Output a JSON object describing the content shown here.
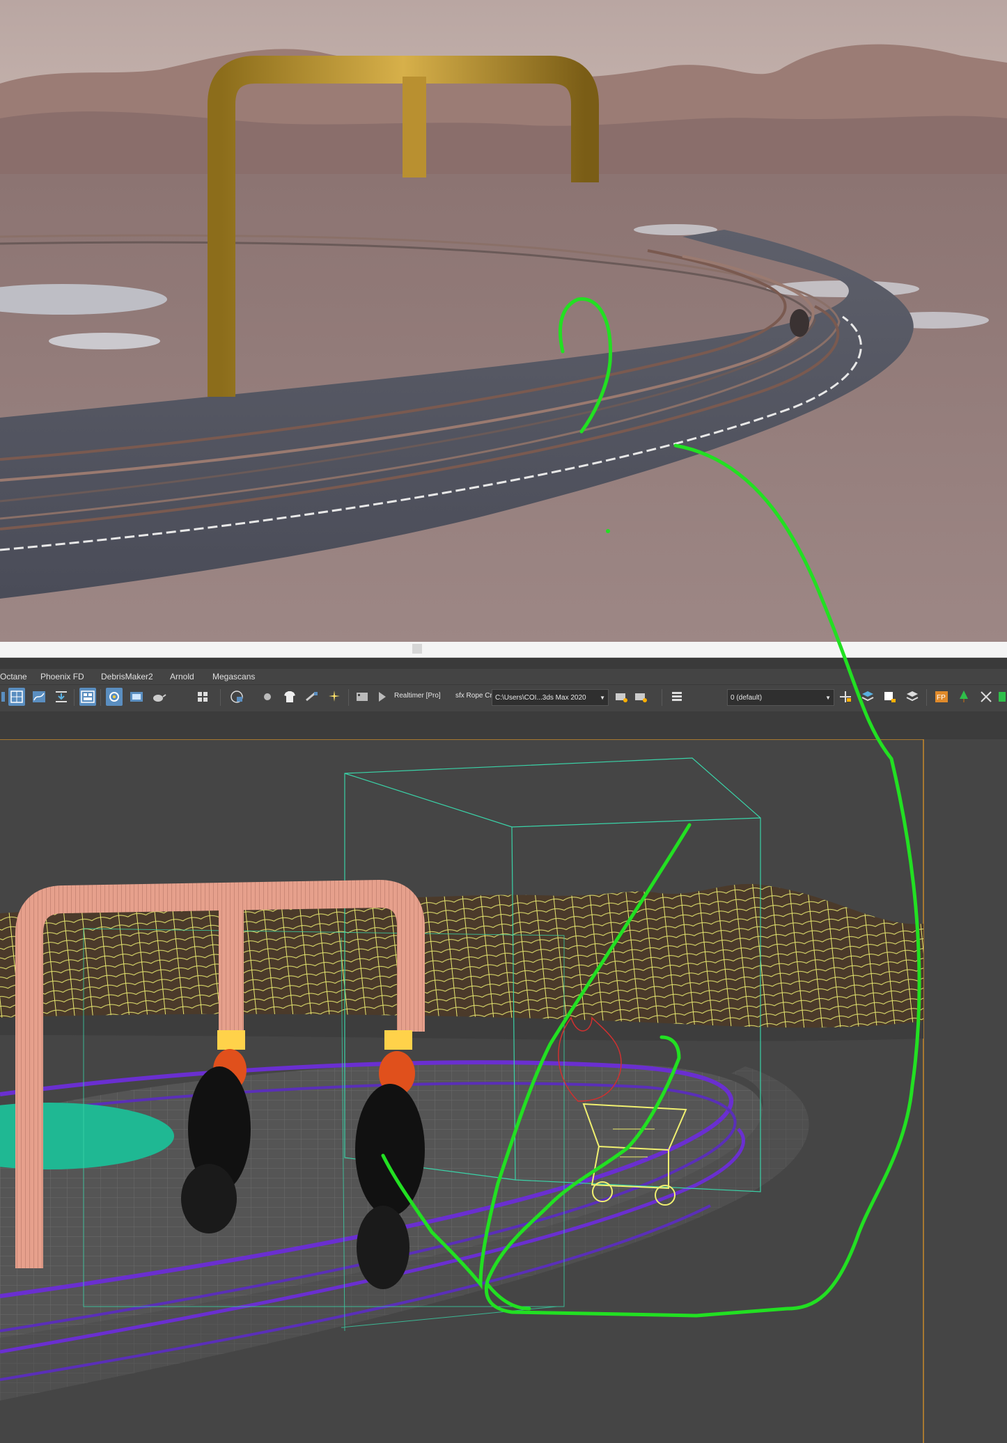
{
  "window": {
    "title": ""
  },
  "menubar": {
    "items": [
      {
        "label": "Octane"
      },
      {
        "label": "Phoenix FD"
      },
      {
        "label": "DebrisMaker2"
      },
      {
        "label": "Arnold"
      },
      {
        "label": "Megascans"
      }
    ]
  },
  "toolbar": {
    "realtime_label": "Realtimer [Pro]",
    "rope_label": "sfx Rope Cr",
    "path_dropdown": "C:\\Users\\COI...3ds Max 2020",
    "layer_dropdown": "0 (default)"
  },
  "icons": {
    "layout": "layout-grid-icon",
    "curve": "curve-editor-icon",
    "schematic": "schematic-view-icon",
    "material": "material-editor-icon",
    "render_setup": "render-setup-icon",
    "render_frame": "render-frame-icon",
    "render_teapot": "render-teapot-icon",
    "sphere": "sphere-icon",
    "shirt": "shirt-icon",
    "layers": "layer-stack-icon",
    "fp": "fp-icon",
    "tree": "tree-icon"
  },
  "colors": {
    "annotation_stroke": "#22e022",
    "pipe_render": "#c9a23a",
    "pipe_wireframe": "#e6a08c",
    "terrain_wire": "#e8e870",
    "track_wire": "#6a2fd0",
    "pond_fill": "#1fb893",
    "box_wire": "#3ad3a8",
    "cart_wire": "#f0f070",
    "toolbar_active": "#5a8ec0"
  }
}
